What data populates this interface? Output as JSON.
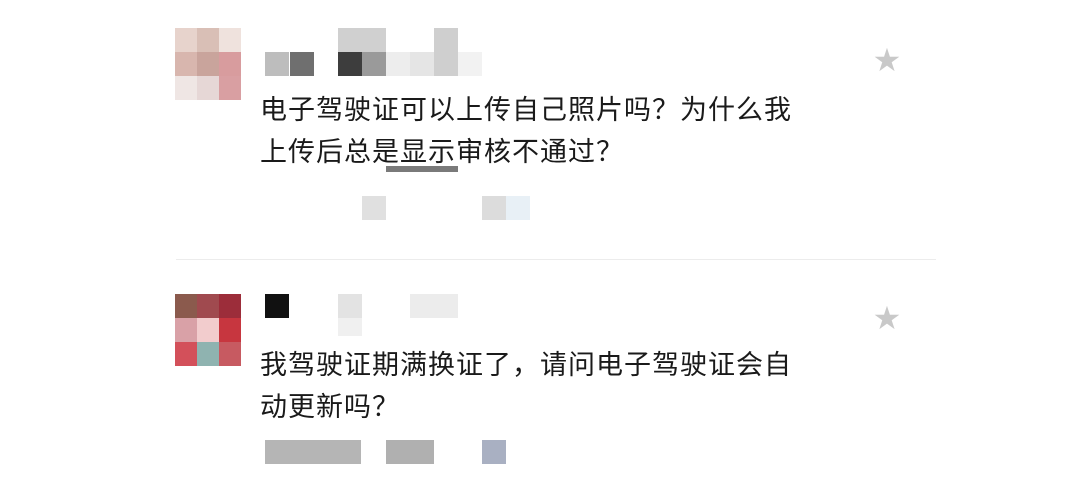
{
  "comments": [
    {
      "text": "电子驾驶证可以上传自己照片吗？为什么我\n上传后总是显示审核不通过？",
      "star_icon": "★"
    },
    {
      "text": "我驾驶证期满换证了，请问电子驾驶证会自\n动更新吗？",
      "star_icon": "★"
    }
  ],
  "colors": {
    "star": "#c9c9c9",
    "divider": "#ececec",
    "text": "#1a1a1a"
  }
}
